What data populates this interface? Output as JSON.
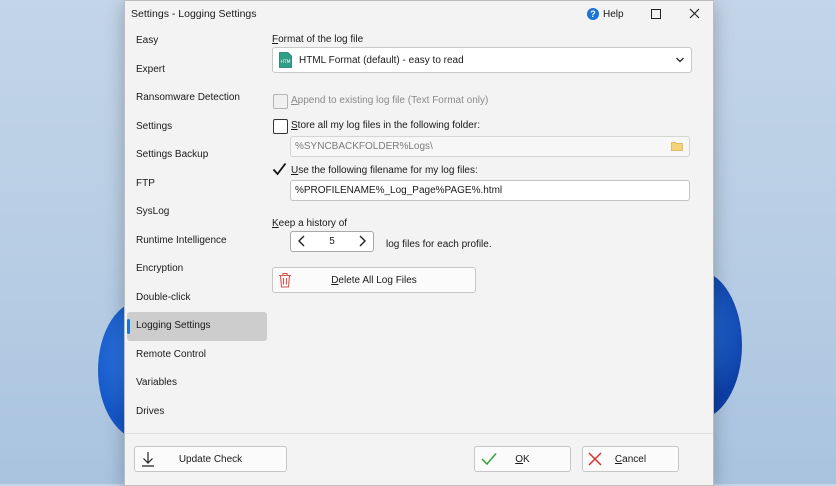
{
  "window": {
    "title": "Settings - Logging Settings",
    "help_label": "Help"
  },
  "sidebar": {
    "items": [
      {
        "label": "Easy"
      },
      {
        "label": "Expert"
      },
      {
        "label": "Ransomware Detection"
      },
      {
        "label": "Settings"
      },
      {
        "label": "Settings Backup"
      },
      {
        "label": "FTP"
      },
      {
        "label": "SysLog"
      },
      {
        "label": "Runtime Intelligence"
      },
      {
        "label": "Encryption"
      },
      {
        "label": "Double-click"
      },
      {
        "label": "Logging Settings"
      },
      {
        "label": "Remote Control"
      },
      {
        "label": "Variables"
      },
      {
        "label": "Drives"
      }
    ],
    "active": "Logging Settings"
  },
  "logging": {
    "format_label_first": "F",
    "format_label_rest": "ormat of the log file",
    "format_value": "HTML Format (default) - easy to read",
    "append_label_first": "A",
    "append_label_rest": "ppend to existing log file (Text Format only)",
    "append_checked": false,
    "store_label_first": "S",
    "store_label_rest": "tore all my log files in the following folder:",
    "store_checked": false,
    "folder_value": "%SYNCBACKFOLDER%Logs\\",
    "use_label_first": "U",
    "use_label_rest": "se the following filename for my log files:",
    "use_checked": true,
    "filename_value": "%PROFILENAME%_Log_Page%PAGE%.html",
    "history_label_first": "K",
    "history_label_rest": "eep a history of",
    "history_value": "5",
    "history_suffix": "log files for each profile.",
    "delete_label_first": "D",
    "delete_label_rest": "elete All Log Files"
  },
  "footer": {
    "update_label": "Update Check",
    "ok_label_first": "O",
    "ok_label_rest": "K",
    "cancel_label_first": "C",
    "cancel_label_rest": "ancel"
  },
  "colors": {
    "accent": "#1b74d8",
    "ok_check": "#3aa13a",
    "cancel_x": "#d9302b",
    "trash": "#d9534f"
  }
}
